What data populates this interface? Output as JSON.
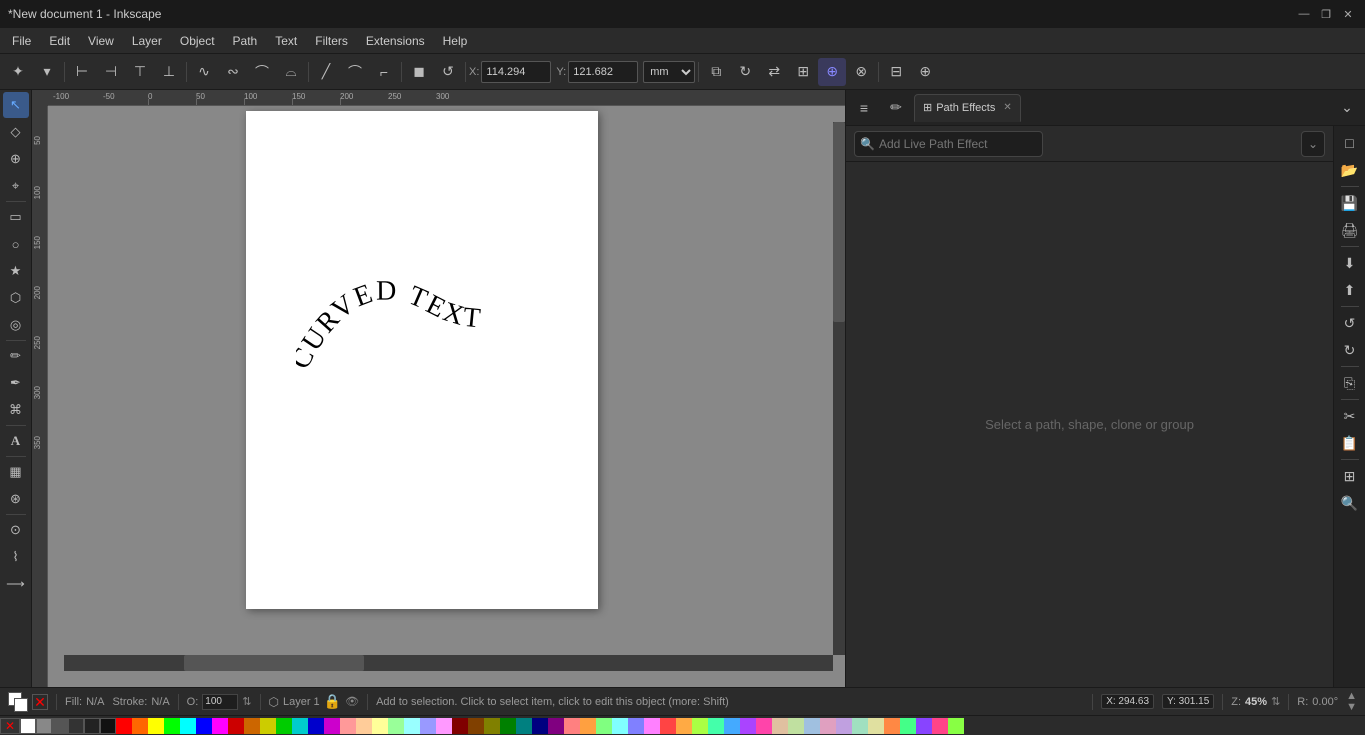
{
  "window": {
    "title": "*New document 1 - Inkscape"
  },
  "win_controls": {
    "minimize": "—",
    "maximize": "❐",
    "close": "✕"
  },
  "menu": {
    "items": [
      "File",
      "Edit",
      "View",
      "Layer",
      "Object",
      "Path",
      "Text",
      "Filters",
      "Extensions",
      "Help"
    ]
  },
  "toolbar": {
    "x_label": "X:",
    "x_value": "114.294",
    "y_label": "Y:",
    "y_value": "121.682",
    "unit": "mm"
  },
  "left_tools": [
    {
      "name": "select-tool",
      "icon": "↖",
      "active": true
    },
    {
      "name": "node-tool",
      "icon": "◇"
    },
    {
      "name": "tweak-tool",
      "icon": "⊕"
    },
    {
      "name": "zoom-tool",
      "icon": "⌖"
    },
    {
      "name": "rect-tool",
      "icon": "▭"
    },
    {
      "name": "circle-tool",
      "icon": "○"
    },
    {
      "name": "star-tool",
      "icon": "★"
    },
    {
      "name": "3d-box-tool",
      "icon": "⬡"
    },
    {
      "name": "spiral-tool",
      "icon": "◎"
    },
    {
      "name": "pencil-tool",
      "icon": "✏"
    },
    {
      "name": "pen-tool",
      "icon": "✒"
    },
    {
      "name": "calligraphy-tool",
      "icon": "⌘"
    },
    {
      "name": "text-tool",
      "icon": "A"
    },
    {
      "name": "gradient-tool",
      "icon": "▦"
    },
    {
      "name": "spray-tool",
      "icon": "⊛"
    },
    {
      "name": "eyedropper-tool",
      "icon": "⊙"
    },
    {
      "name": "measure-tool",
      "icon": "⌇"
    },
    {
      "name": "connector-tool",
      "icon": "⟶"
    }
  ],
  "panel": {
    "tabs": [
      {
        "id": "tab1",
        "icon": "≡",
        "label": "",
        "active": false
      },
      {
        "id": "tab2",
        "icon": "✏",
        "label": "",
        "active": false
      },
      {
        "id": "tab3",
        "icon": "⊞",
        "label": "Path Effects",
        "active": true,
        "closable": true
      }
    ],
    "expand_icon": "⌄",
    "add_lpe_placeholder": "Add Live Path Effect",
    "dropdown_icon": "⌄",
    "status_text": "Select a path, shape, clone or group"
  },
  "right_panel_icons": [
    {
      "name": "new-icon",
      "icon": "□"
    },
    {
      "name": "open-icon",
      "icon": "📂"
    },
    {
      "name": "save-icon",
      "icon": "💾"
    },
    {
      "name": "print-icon",
      "icon": "🖨"
    },
    {
      "name": "import-icon",
      "icon": "⬇"
    },
    {
      "name": "export-icon",
      "icon": "⬆"
    },
    {
      "name": "undo-icon",
      "icon": "↺"
    },
    {
      "name": "redo-icon",
      "icon": "↻"
    },
    {
      "name": "copy-icon",
      "icon": "⎘"
    },
    {
      "name": "cut-icon",
      "icon": "✂"
    },
    {
      "name": "paste-icon",
      "icon": "📋"
    },
    {
      "name": "zoom-fit-icon",
      "icon": "⊞"
    },
    {
      "name": "zoom-in-icon",
      "icon": "🔍"
    }
  ],
  "canvas": {
    "ruler_labels": [
      "-100",
      "-50",
      "0",
      "50",
      "100",
      "150",
      "200",
      "250",
      "300"
    ],
    "v_ruler_labels": [
      "50",
      "100",
      "150",
      "200",
      "250",
      "300",
      "350"
    ]
  },
  "status_bar": {
    "opacity_label": "O:",
    "opacity_value": "100",
    "layer": "Layer 1",
    "hint": "Add to selection. Click to select item, click to edit this object (more: Shift)",
    "x_coord": "X: 294.63",
    "y_coord": "Y: 301.15",
    "zoom_label": "Z:",
    "zoom_value": "45%",
    "rotation_label": "R:",
    "rotation_value": "0.00°",
    "fill_label": "Fill:",
    "fill_value": "N/A",
    "stroke_label": "Stroke:",
    "stroke_value": "N/A"
  },
  "colors": {
    "bg_dark": "#2b2b2b",
    "bg_darker": "#1e1e1e",
    "canvas_gray": "#888888",
    "page_white": "#ffffff",
    "accent_blue": "#3a5a8a"
  }
}
